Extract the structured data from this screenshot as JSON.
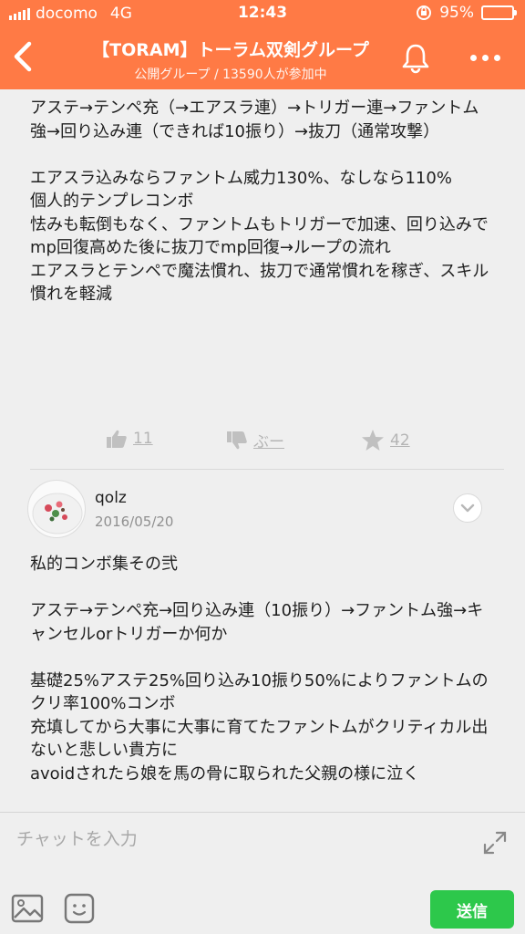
{
  "status_bar": {
    "carrier": "docomo",
    "network": "4G",
    "time": "12:43",
    "battery_percent": "95%",
    "battery_level": 0.95,
    "battery_color": "#5ee04a"
  },
  "header": {
    "title": "【TORAM】トーラム双剣グループ",
    "subtitle": "公開グループ / 13590人が参加中",
    "background_color": "#ff7a45",
    "back_icon": "chevron-left-icon",
    "bell_icon": "bell-icon",
    "more_icon": "more-dots-icon"
  },
  "posts": [
    {
      "text": "アステ→テンペ充（→エアスラ連）→トリガー連→ファントム強→回り込み連（できれば10振り）→抜刀（通常攻撃）\n\nエアスラ込みならファントム威力130%、なしなら110%\n個人的テンプレコンボ\n怯みも転倒もなく、ファントムもトリガーで加速、回り込みでmp回復高めた後に抜刀でmp回復→ループの流れ\nエアスラとテンペで魔法慣れ、抜刀で通常慣れを稼ぎ、スキル慣れを軽減",
      "likes": "11",
      "dislike_label": "ぶー",
      "favorites": "42"
    },
    {
      "username": "qolz",
      "date": "2016/05/20",
      "text": "私的コンボ集その弐\n\nアステ→テンペ充→回り込み連（10振り）→ファントム強→キャンセルorトリガーか何か\n\n基礎25%アステ25%回り込み10振り50%によりファントムのクリ率100%コンボ\n充填してから大事に大事に育てたファントムがクリティカル出ないと悲しい貴方に\navoidされたら娘を馬の骨に取られた父親の様に泣く"
    }
  ],
  "input_bar": {
    "placeholder": "チャットを入力",
    "value": "",
    "send_label": "送信",
    "send_color": "#2dc84b"
  }
}
